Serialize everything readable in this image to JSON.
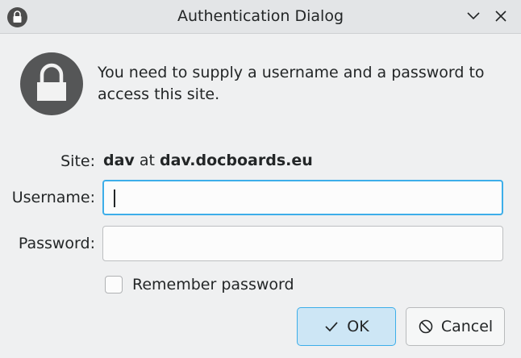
{
  "window": {
    "title": "Authentication Dialog",
    "title_icon": "lock-icon",
    "minimize_icon": "chevron-down-icon",
    "close_icon": "close-icon"
  },
  "dialog": {
    "icon": "lock-icon",
    "message": "You need to supply a username and a password to access this site.",
    "site_label": "Site:",
    "site_user": "dav",
    "site_at": "at",
    "site_host": "dav.docboards.eu",
    "username_label": "Username:",
    "username_value": "",
    "password_label": "Password:",
    "password_value": "",
    "remember_label": "Remember password",
    "remember_checked": false,
    "ok_label": "OK",
    "ok_icon": "checkmark-icon",
    "cancel_label": "Cancel",
    "cancel_icon": "cancel-icon"
  },
  "colors": {
    "accent": "#3daee9",
    "window_bg": "#eff0f1",
    "ok_bg": "#cde6f5"
  }
}
